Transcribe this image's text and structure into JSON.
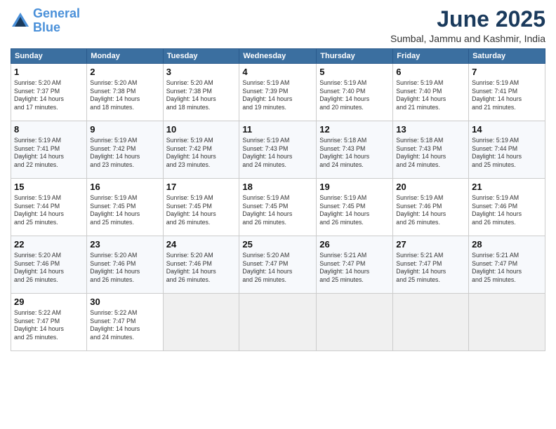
{
  "logo": {
    "line1": "General",
    "line2": "Blue"
  },
  "title": "June 2025",
  "location": "Sumbal, Jammu and Kashmir, India",
  "headers": [
    "Sunday",
    "Monday",
    "Tuesday",
    "Wednesday",
    "Thursday",
    "Friday",
    "Saturday"
  ],
  "weeks": [
    [
      {
        "day": "1",
        "info": "Sunrise: 5:20 AM\nSunset: 7:37 PM\nDaylight: 14 hours\nand 17 minutes."
      },
      {
        "day": "2",
        "info": "Sunrise: 5:20 AM\nSunset: 7:38 PM\nDaylight: 14 hours\nand 18 minutes."
      },
      {
        "day": "3",
        "info": "Sunrise: 5:20 AM\nSunset: 7:38 PM\nDaylight: 14 hours\nand 18 minutes."
      },
      {
        "day": "4",
        "info": "Sunrise: 5:19 AM\nSunset: 7:39 PM\nDaylight: 14 hours\nand 19 minutes."
      },
      {
        "day": "5",
        "info": "Sunrise: 5:19 AM\nSunset: 7:40 PM\nDaylight: 14 hours\nand 20 minutes."
      },
      {
        "day": "6",
        "info": "Sunrise: 5:19 AM\nSunset: 7:40 PM\nDaylight: 14 hours\nand 21 minutes."
      },
      {
        "day": "7",
        "info": "Sunrise: 5:19 AM\nSunset: 7:41 PM\nDaylight: 14 hours\nand 21 minutes."
      }
    ],
    [
      {
        "day": "8",
        "info": "Sunrise: 5:19 AM\nSunset: 7:41 PM\nDaylight: 14 hours\nand 22 minutes."
      },
      {
        "day": "9",
        "info": "Sunrise: 5:19 AM\nSunset: 7:42 PM\nDaylight: 14 hours\nand 23 minutes."
      },
      {
        "day": "10",
        "info": "Sunrise: 5:19 AM\nSunset: 7:42 PM\nDaylight: 14 hours\nand 23 minutes."
      },
      {
        "day": "11",
        "info": "Sunrise: 5:19 AM\nSunset: 7:43 PM\nDaylight: 14 hours\nand 24 minutes."
      },
      {
        "day": "12",
        "info": "Sunrise: 5:18 AM\nSunset: 7:43 PM\nDaylight: 14 hours\nand 24 minutes."
      },
      {
        "day": "13",
        "info": "Sunrise: 5:18 AM\nSunset: 7:43 PM\nDaylight: 14 hours\nand 24 minutes."
      },
      {
        "day": "14",
        "info": "Sunrise: 5:19 AM\nSunset: 7:44 PM\nDaylight: 14 hours\nand 25 minutes."
      }
    ],
    [
      {
        "day": "15",
        "info": "Sunrise: 5:19 AM\nSunset: 7:44 PM\nDaylight: 14 hours\nand 25 minutes."
      },
      {
        "day": "16",
        "info": "Sunrise: 5:19 AM\nSunset: 7:45 PM\nDaylight: 14 hours\nand 25 minutes."
      },
      {
        "day": "17",
        "info": "Sunrise: 5:19 AM\nSunset: 7:45 PM\nDaylight: 14 hours\nand 26 minutes."
      },
      {
        "day": "18",
        "info": "Sunrise: 5:19 AM\nSunset: 7:45 PM\nDaylight: 14 hours\nand 26 minutes."
      },
      {
        "day": "19",
        "info": "Sunrise: 5:19 AM\nSunset: 7:45 PM\nDaylight: 14 hours\nand 26 minutes."
      },
      {
        "day": "20",
        "info": "Sunrise: 5:19 AM\nSunset: 7:46 PM\nDaylight: 14 hours\nand 26 minutes."
      },
      {
        "day": "21",
        "info": "Sunrise: 5:19 AM\nSunset: 7:46 PM\nDaylight: 14 hours\nand 26 minutes."
      }
    ],
    [
      {
        "day": "22",
        "info": "Sunrise: 5:20 AM\nSunset: 7:46 PM\nDaylight: 14 hours\nand 26 minutes."
      },
      {
        "day": "23",
        "info": "Sunrise: 5:20 AM\nSunset: 7:46 PM\nDaylight: 14 hours\nand 26 minutes."
      },
      {
        "day": "24",
        "info": "Sunrise: 5:20 AM\nSunset: 7:46 PM\nDaylight: 14 hours\nand 26 minutes."
      },
      {
        "day": "25",
        "info": "Sunrise: 5:20 AM\nSunset: 7:47 PM\nDaylight: 14 hours\nand 26 minutes."
      },
      {
        "day": "26",
        "info": "Sunrise: 5:21 AM\nSunset: 7:47 PM\nDaylight: 14 hours\nand 25 minutes."
      },
      {
        "day": "27",
        "info": "Sunrise: 5:21 AM\nSunset: 7:47 PM\nDaylight: 14 hours\nand 25 minutes."
      },
      {
        "day": "28",
        "info": "Sunrise: 5:21 AM\nSunset: 7:47 PM\nDaylight: 14 hours\nand 25 minutes."
      }
    ],
    [
      {
        "day": "29",
        "info": "Sunrise: 5:22 AM\nSunset: 7:47 PM\nDaylight: 14 hours\nand 25 minutes."
      },
      {
        "day": "30",
        "info": "Sunrise: 5:22 AM\nSunset: 7:47 PM\nDaylight: 14 hours\nand 24 minutes."
      },
      {
        "day": "",
        "info": ""
      },
      {
        "day": "",
        "info": ""
      },
      {
        "day": "",
        "info": ""
      },
      {
        "day": "",
        "info": ""
      },
      {
        "day": "",
        "info": ""
      }
    ]
  ]
}
